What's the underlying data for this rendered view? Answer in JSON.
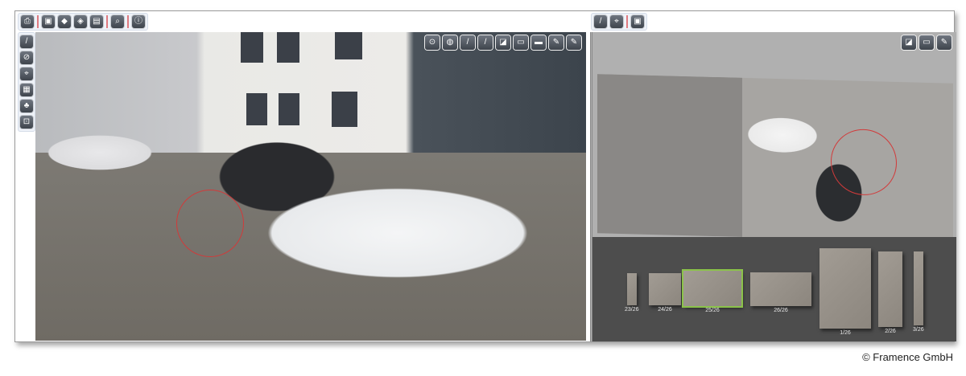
{
  "left_toolbar": [
    {
      "name": "print-icon",
      "glyph": "⎙"
    },
    {
      "sep": true
    },
    {
      "name": "save-icon",
      "glyph": "▣"
    },
    {
      "name": "export-3d-icon",
      "glyph": "◆"
    },
    {
      "name": "export-model-icon",
      "glyph": "◈"
    },
    {
      "name": "image-export-icon",
      "glyph": "▤"
    },
    {
      "sep": true
    },
    {
      "name": "search-icon",
      "glyph": "⌕"
    },
    {
      "sep": true
    },
    {
      "name": "info-icon",
      "glyph": "ⓘ"
    }
  ],
  "vertical_toolbar": [
    {
      "name": "ruler-icon",
      "glyph": "/"
    },
    {
      "name": "hide-icon",
      "glyph": "⊘"
    },
    {
      "name": "map-pin-icon",
      "glyph": "⌖"
    },
    {
      "name": "camera-positions-icon",
      "glyph": "▦"
    },
    {
      "name": "terrain-icon",
      "glyph": "♣"
    },
    {
      "name": "zoom-region-icon",
      "glyph": "⊡"
    }
  ],
  "overlay_toolbar": [
    {
      "name": "location-marker-icon",
      "glyph": "⊙"
    },
    {
      "name": "globe-icon",
      "glyph": "◍"
    },
    {
      "name": "line-icon",
      "glyph": "/"
    },
    {
      "name": "red-line-icon",
      "glyph": "/"
    },
    {
      "name": "resize-icon",
      "glyph": "◪"
    },
    {
      "name": "image-icon",
      "glyph": "▭"
    },
    {
      "name": "panorama-icon",
      "glyph": "▬"
    },
    {
      "name": "edit-image-icon",
      "glyph": "✎"
    },
    {
      "name": "edit-panorama-icon",
      "glyph": "✎"
    }
  ],
  "right_toolbar": [
    {
      "name": "ruler-icon",
      "glyph": "/"
    },
    {
      "name": "map-pin-icon",
      "glyph": "⌖"
    },
    {
      "sep": true
    },
    {
      "name": "save-icon",
      "glyph": "▣"
    }
  ],
  "right_overlay_toolbar": [
    {
      "name": "resize-icon",
      "glyph": "◪"
    },
    {
      "name": "image-icon",
      "glyph": "▭"
    },
    {
      "name": "edit-image-icon",
      "glyph": "✎"
    }
  ],
  "thumbnails": [
    {
      "label": "23/26",
      "selected": false
    },
    {
      "label": "24/26",
      "selected": false
    },
    {
      "label": "25/26",
      "selected": true
    },
    {
      "label": "26/26",
      "selected": false
    },
    {
      "label": "1/26",
      "selected": false
    },
    {
      "label": "2/26",
      "selected": false
    },
    {
      "label": "3/26",
      "selected": false
    }
  ],
  "copyright": "© Framence GmbH"
}
